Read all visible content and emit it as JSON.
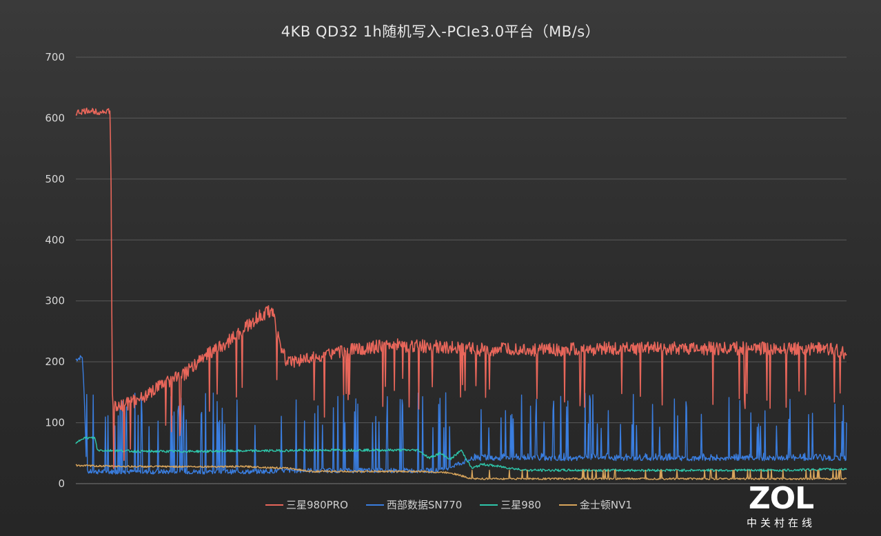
{
  "chart_data": {
    "type": "line",
    "title": "4KB QD32 1h随机写入-PCIe3.0平台（MB/s）",
    "xlabel": "",
    "ylabel": "",
    "ylim": [
      0,
      700
    ],
    "yticks": [
      "0",
      "100",
      "200",
      "300",
      "400",
      "500",
      "600",
      "700"
    ],
    "grid": true,
    "legend_position": "bottom",
    "x_range": [
      0,
      3600
    ],
    "series": [
      {
        "name": "三星980PRO",
        "color": "#e8665a",
        "values": [
          [
            0,
            608
          ],
          [
            60,
            612
          ],
          [
            120,
            610
          ],
          [
            150,
            612
          ],
          [
            160,
            610
          ],
          [
            165,
            480
          ],
          [
            170,
            150
          ],
          [
            175,
            125
          ],
          [
            260,
            133
          ],
          [
            340,
            148
          ],
          [
            420,
            165
          ],
          [
            500,
            178
          ],
          [
            560,
            195
          ],
          [
            620,
            215
          ],
          [
            700,
            230
          ],
          [
            800,
            258
          ],
          [
            860,
            275
          ],
          [
            920,
            285
          ],
          [
            950,
            230
          ],
          [
            980,
            205
          ],
          [
            1000,
            200
          ],
          [
            1100,
            205
          ],
          [
            1300,
            220
          ],
          [
            1400,
            225
          ],
          [
            1500,
            227
          ],
          [
            1700,
            225
          ],
          [
            1900,
            220
          ],
          [
            2100,
            220
          ],
          [
            2300,
            220
          ],
          [
            2500,
            222
          ],
          [
            2700,
            222
          ],
          [
            2900,
            222
          ],
          [
            3100,
            222
          ],
          [
            3300,
            222
          ],
          [
            3500,
            222
          ],
          [
            3600,
            215
          ]
        ]
      },
      {
        "name": "西部数据SN770",
        "color": "#3a7ee0",
        "values": [
          [
            0,
            202
          ],
          [
            30,
            207
          ],
          [
            40,
            140
          ],
          [
            50,
            18
          ],
          [
            200,
            18
          ],
          [
            500,
            18
          ],
          [
            800,
            18
          ],
          [
            1000,
            20
          ],
          [
            1100,
            20
          ],
          [
            1400,
            20
          ],
          [
            1600,
            20
          ],
          [
            1700,
            20
          ],
          [
            1860,
            40
          ],
          [
            2000,
            40
          ],
          [
            2300,
            40
          ],
          [
            2600,
            40
          ],
          [
            2900,
            40
          ],
          [
            3200,
            40
          ],
          [
            3600,
            40
          ]
        ]
      },
      {
        "name": "三星980",
        "color": "#2ec6aa",
        "values": [
          [
            0,
            65
          ],
          [
            30,
            75
          ],
          [
            90,
            75
          ],
          [
            100,
            55
          ],
          [
            300,
            53
          ],
          [
            600,
            53
          ],
          [
            900,
            54
          ],
          [
            1200,
            55
          ],
          [
            1500,
            55
          ],
          [
            1600,
            55
          ],
          [
            1650,
            42
          ],
          [
            1700,
            50
          ],
          [
            1750,
            40
          ],
          [
            1800,
            55
          ],
          [
            1850,
            25
          ],
          [
            1900,
            32
          ],
          [
            2100,
            22
          ],
          [
            2400,
            22
          ],
          [
            2700,
            22
          ],
          [
            3000,
            22
          ],
          [
            3300,
            22
          ],
          [
            3600,
            24
          ]
        ]
      },
      {
        "name": "金士顿NV1",
        "color": "#d9a55b",
        "values": [
          [
            0,
            30
          ],
          [
            100,
            29
          ],
          [
            300,
            28
          ],
          [
            500,
            28
          ],
          [
            600,
            28
          ],
          [
            800,
            28
          ],
          [
            1000,
            25
          ],
          [
            1100,
            20
          ],
          [
            1400,
            20
          ],
          [
            1600,
            20
          ],
          [
            1750,
            18
          ],
          [
            1850,
            8
          ],
          [
            2100,
            8
          ],
          [
            2400,
            8
          ],
          [
            2700,
            8
          ],
          [
            3000,
            8
          ],
          [
            3300,
            8
          ],
          [
            3600,
            8
          ]
        ]
      }
    ]
  },
  "watermark": {
    "main": "ZOL",
    "sub": "中关村在线"
  }
}
